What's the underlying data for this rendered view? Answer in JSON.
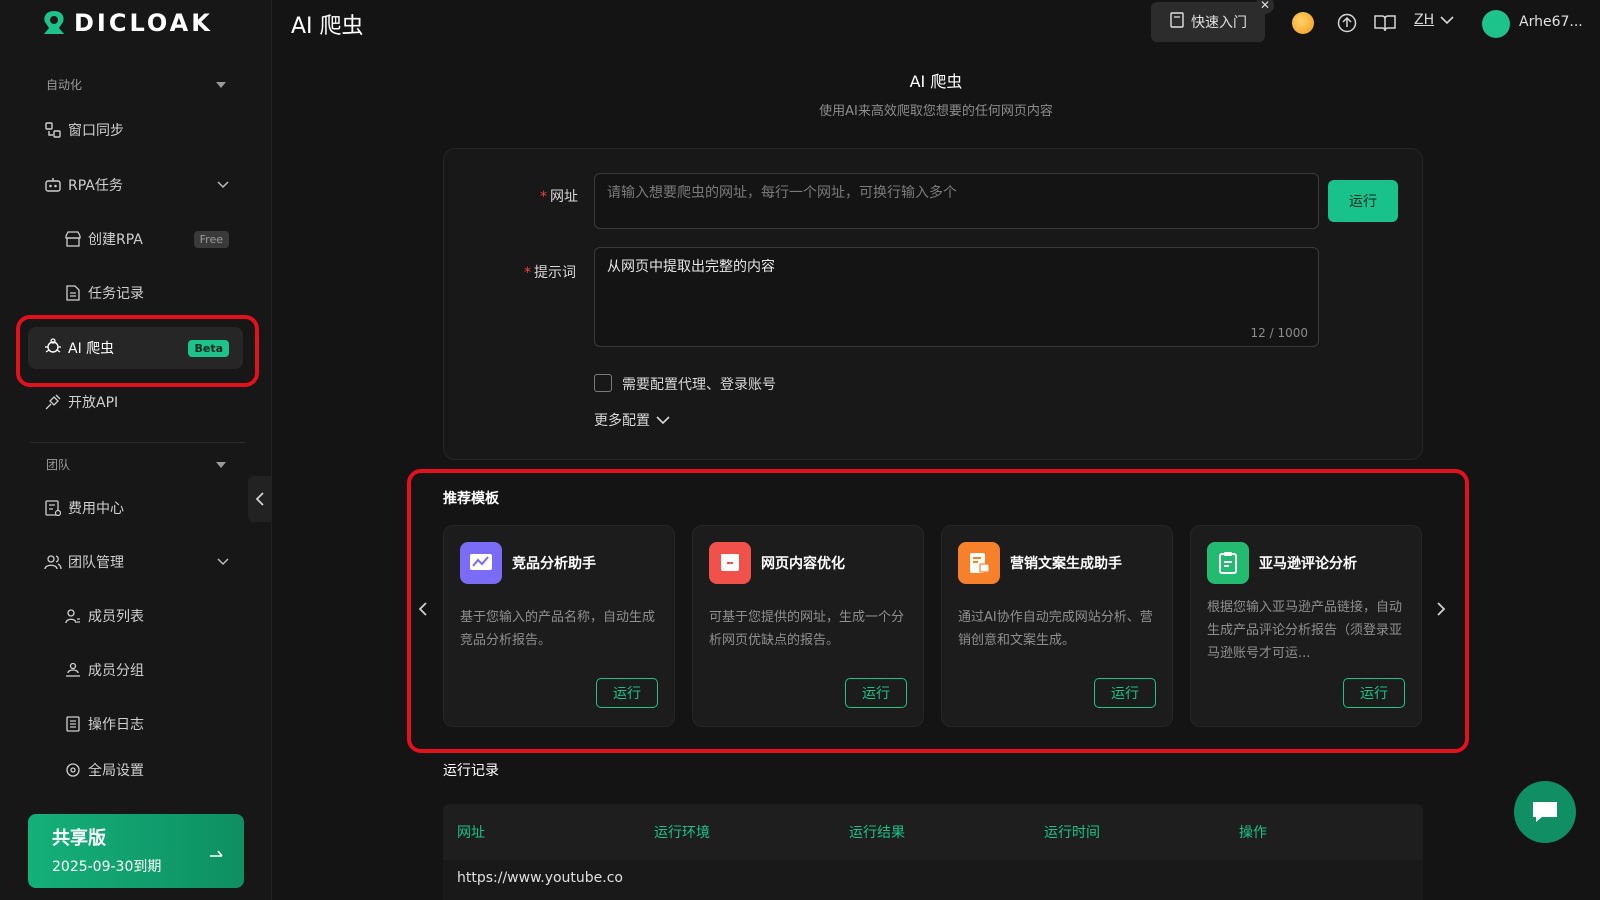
{
  "app": {
    "logo_text": "DICLOAK",
    "page_title": "AI 爬虫"
  },
  "sidebar": {
    "section_automation": "自动化",
    "window_sync": "窗口同步",
    "rpa_tasks": "RPA任务",
    "create_rpa": "创建RPA",
    "free_badge": "Free",
    "task_records": "任务记录",
    "ai_crawler": "AI 爬虫",
    "beta_badge": "Beta",
    "open_api": "开放API",
    "section_team": "团队",
    "billing": "费用中心",
    "team_mgmt": "团队管理",
    "member_list": "成员列表",
    "member_groups": "成员分组",
    "op_logs": "操作日志",
    "global_settings": "全局设置",
    "plan_name": "共享版",
    "plan_expiry": "2025-09-30到期"
  },
  "topbar": {
    "quick_entry": "快速入门",
    "lang": "ZH",
    "username": "Arhe67..."
  },
  "hero": {
    "title": "AI 爬虫",
    "subtitle": "使用AI来高效爬取您想要的任何网页内容"
  },
  "form": {
    "url_label": "网址",
    "url_placeholder": "请输入想要爬虫的网址，每行一个网址，可换行输入多个",
    "run_label": "运行",
    "prompt_label": "提示词",
    "prompt_value": "从网页中提取出完整的内容",
    "prompt_counter": "12 / 1000",
    "proxy_checkbox_label": "需要配置代理、登录账号",
    "more_config": "更多配置"
  },
  "templates": {
    "title": "推荐模板",
    "items": [
      {
        "name": "竞品分析助手",
        "desc": "基于您输入的产品名称，自动生成竞品分析报告。",
        "run": "运行",
        "color": "#7b6cf6"
      },
      {
        "name": "网页内容优化",
        "desc": "可基于您提供的网址，生成一个分析网页优缺点的报告。",
        "run": "运行",
        "color": "#f0514a"
      },
      {
        "name": "营销文案生成助手",
        "desc": "通过AI协作自动完成网站分析、营销创意和文案生成。",
        "run": "运行",
        "color": "#f7812b"
      },
      {
        "name": "亚马逊评论分析",
        "desc": "根据您输入亚马逊产品链接，自动生成产品评论分析报告（须登录亚马逊账号才可运...",
        "run": "运行",
        "color": "#22bb6f"
      }
    ]
  },
  "records": {
    "title": "运行记录",
    "columns": [
      "网址",
      "运行环境",
      "运行结果",
      "运行时间",
      "操作"
    ],
    "rows": [
      {
        "url": "https://www.youtube.co"
      }
    ]
  },
  "colors": {
    "accent": "#19c28a",
    "highlight": "#e3101e"
  }
}
